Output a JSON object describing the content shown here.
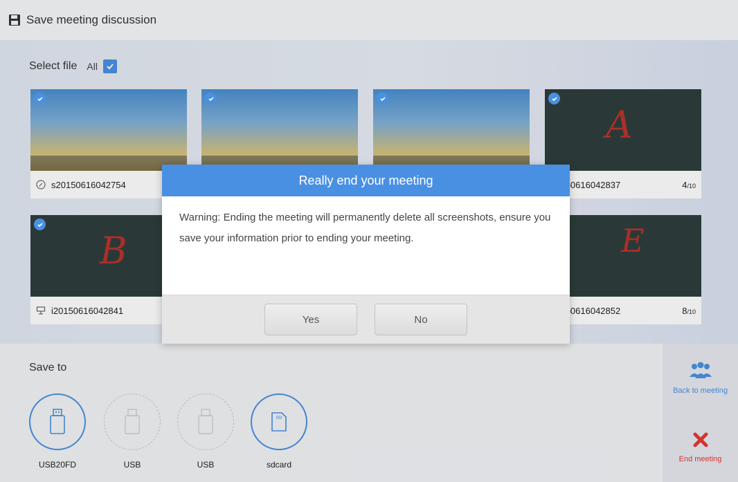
{
  "header": {
    "title": "Save meeting discussion",
    "icon": "floppy-disk-icon"
  },
  "select": {
    "label": "Select file",
    "all_label": "All",
    "all_checked": true
  },
  "files": [
    {
      "name": "s20150616042754",
      "page": "",
      "type": "desktop",
      "checked": true,
      "icon": "clock-icon"
    },
    {
      "name": "",
      "page": "",
      "type": "desktop",
      "checked": true
    },
    {
      "name": "",
      "page": "",
      "type": "desktop",
      "checked": true
    },
    {
      "name": "20150616042837",
      "page": "4",
      "page_total": "/10",
      "type": "whiteboard",
      "letter": "A",
      "checked": true
    },
    {
      "name": "i20150616042841",
      "page": "",
      "type": "whiteboard",
      "letter": "B",
      "checked": true,
      "icon": "whiteboard-icon"
    },
    {
      "name": "20150616042852",
      "page": "8",
      "page_total": "/10",
      "type": "whiteboard",
      "letter": "E",
      "checked": false
    }
  ],
  "save_to": {
    "label": "Save to",
    "devices": [
      {
        "label": "USB20FD",
        "icon": "usb-drive-icon",
        "active": true
      },
      {
        "label": "USB",
        "icon": "usb-drive-icon",
        "active": false
      },
      {
        "label": "USB",
        "icon": "usb-drive-icon",
        "active": false
      },
      {
        "label": "sdcard",
        "icon": "sd-card-icon",
        "active": true
      }
    ]
  },
  "sidebar": {
    "back_label": "Back to meeting",
    "end_label": "End meeting",
    "back_icon": "people-icon",
    "end_icon": "close-x-icon"
  },
  "dialog": {
    "title": "Really end your meeting",
    "message": "Warning: Ending the meeting will permanently delete all screenshots, ensure you save your information prior to ending your meeting.",
    "yes_label": "Yes",
    "no_label": "No"
  },
  "colors": {
    "accent": "#4a90e2",
    "danger": "#e53935",
    "ink": "#b8332d",
    "board": "#2e3e3c"
  }
}
